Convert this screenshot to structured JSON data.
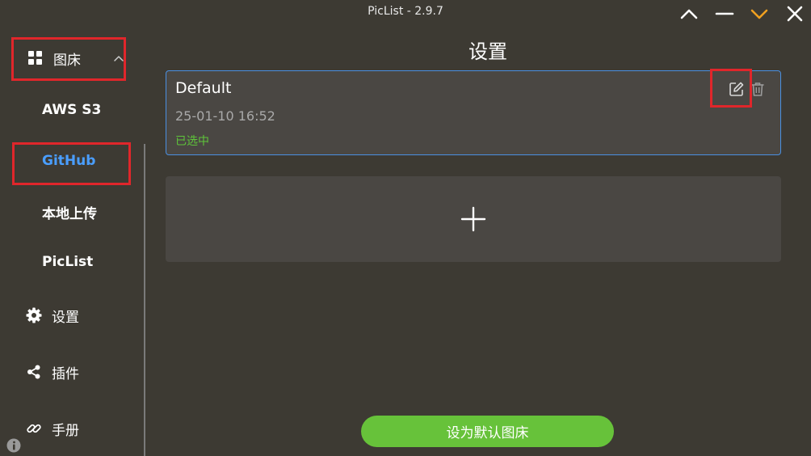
{
  "window": {
    "title": "PicList - 2.9.7",
    "controls": [
      "chevron-up-icon",
      "minimize-icon",
      "chevron-down-icon",
      "close-icon"
    ],
    "accent_color": "#f0a020"
  },
  "sidebar": {
    "picbed_label": "图床",
    "picbed_items": [
      {
        "label": "AWS S3"
      },
      {
        "label": "GitHub",
        "active": true
      },
      {
        "label": "本地上传"
      },
      {
        "label": "PicList"
      }
    ],
    "menu": [
      {
        "label": "设置",
        "icon": "gear-icon"
      },
      {
        "label": "插件",
        "icon": "share-icon"
      },
      {
        "label": "手册",
        "icon": "link-icon"
      }
    ],
    "active_color": "#4a9eff"
  },
  "main": {
    "title": "设置",
    "config": {
      "name": "Default",
      "date": "25-01-10 16:52",
      "status": "已选中",
      "status_color": "#5ec43a",
      "border_color": "#4a90e2"
    },
    "add_icon": "plus-icon",
    "default_button": "设为默认图床",
    "button_color": "#67c23a"
  },
  "highlight_color": "#e0262b"
}
